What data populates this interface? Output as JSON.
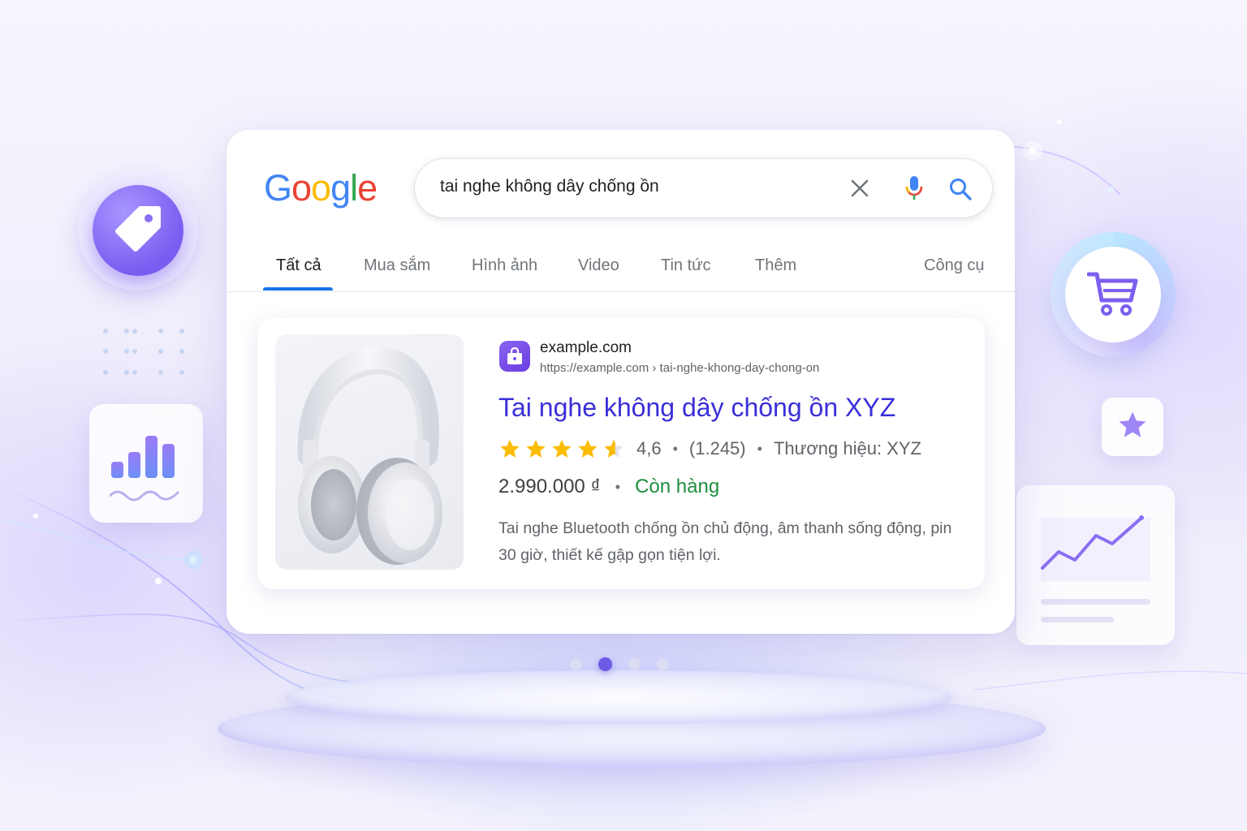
{
  "logo": {
    "letters": [
      "G",
      "o",
      "o",
      "g",
      "l",
      "e"
    ],
    "colors": [
      "#4285f4",
      "#ea4335",
      "#fbbc05",
      "#4285f4",
      "#34a853",
      "#ea4335"
    ]
  },
  "search": {
    "query": "tai nghe không dây chống ồn",
    "clear_icon": "close-icon",
    "mic_icon": "microphone-icon",
    "search_icon": "search-icon"
  },
  "tabs": [
    {
      "label": "Tất cả",
      "active": true
    },
    {
      "label": "Mua sắm"
    },
    {
      "label": "Hình ảnh"
    },
    {
      "label": "Video"
    },
    {
      "label": "Tin tức"
    },
    {
      "label": "Thêm"
    }
  ],
  "tools_label": "Công cụ",
  "result": {
    "site_name": "example.com",
    "url": "https://example.com › tai-nghe-khong-day-chong-on",
    "title": "Tai nghe không dây chống ồn XYZ",
    "rating": 4.6,
    "rating_text": "4,6",
    "review_count": "(1.245)",
    "brand": "Thương hiệu: XYZ",
    "price": "2.990.000 ₫",
    "stock": "Còn hàng",
    "description": "Tai nghe Bluetooth chống ồn chủ động, âm thanh sống động, pin 30 giờ, thiết kế gập gọn tiện lợi.",
    "image_icon": "headphones-image",
    "favicon": "shopping-bag-icon"
  },
  "pagination": {
    "count": 4,
    "active_index": 1
  },
  "colors": {
    "accent": "#6f5ae6",
    "link": "#3a2fd8",
    "in_stock": "#1e8e3e",
    "star": "#fbbc04",
    "tab_indicator": "#1a73e8"
  },
  "decor_icons": [
    "price-tag-icon",
    "bar-chart-icon",
    "shopping-cart-icon",
    "star-icon",
    "trend-line-icon"
  ]
}
